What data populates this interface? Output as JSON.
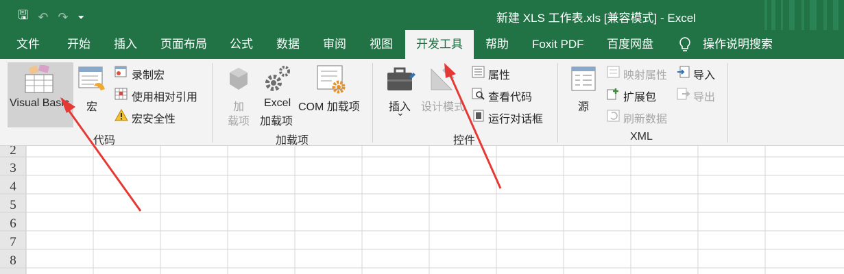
{
  "title": "新建 XLS 工作表.xls  [兼容模式]  -  Excel",
  "qat": {
    "save": "🖫",
    "undo": "↶",
    "redo": "↷",
    "more": "⏷"
  },
  "tabs": [
    "文件",
    "开始",
    "插入",
    "页面布局",
    "公式",
    "数据",
    "审阅",
    "视图",
    "开发工具",
    "帮助",
    "Foxit PDF",
    "百度网盘",
    "操作说明搜索"
  ],
  "active_tab": "开发工具",
  "ribbon": {
    "code": {
      "label": "代码",
      "visual_basic": "Visual Basic",
      "macros": "宏",
      "record_macro": "录制宏",
      "relative_ref": "使用相对引用",
      "macro_security": "宏安全性"
    },
    "addins": {
      "label": "加载项",
      "addins_line1": "加",
      "addins_line2": "载项",
      "excel_line1": "Excel",
      "excel_line2": "加载项",
      "com": "COM 加载项"
    },
    "controls": {
      "label": "控件",
      "insert": "插入",
      "insert_arrow": "⌄",
      "design_mode": "设计模式",
      "properties": "属性",
      "view_code": "查看代码",
      "run_dialog": "运行对话框"
    },
    "xml": {
      "label": "XML",
      "source": "源",
      "map_props": "映射属性",
      "expansion": "扩展包",
      "refresh": "刷新数据",
      "import": "导入",
      "export": "导出"
    }
  },
  "rows": [
    "2",
    "3",
    "4",
    "5",
    "6",
    "7",
    "8"
  ],
  "colors": {
    "brand": "#217346",
    "arrow": "#e53935"
  }
}
